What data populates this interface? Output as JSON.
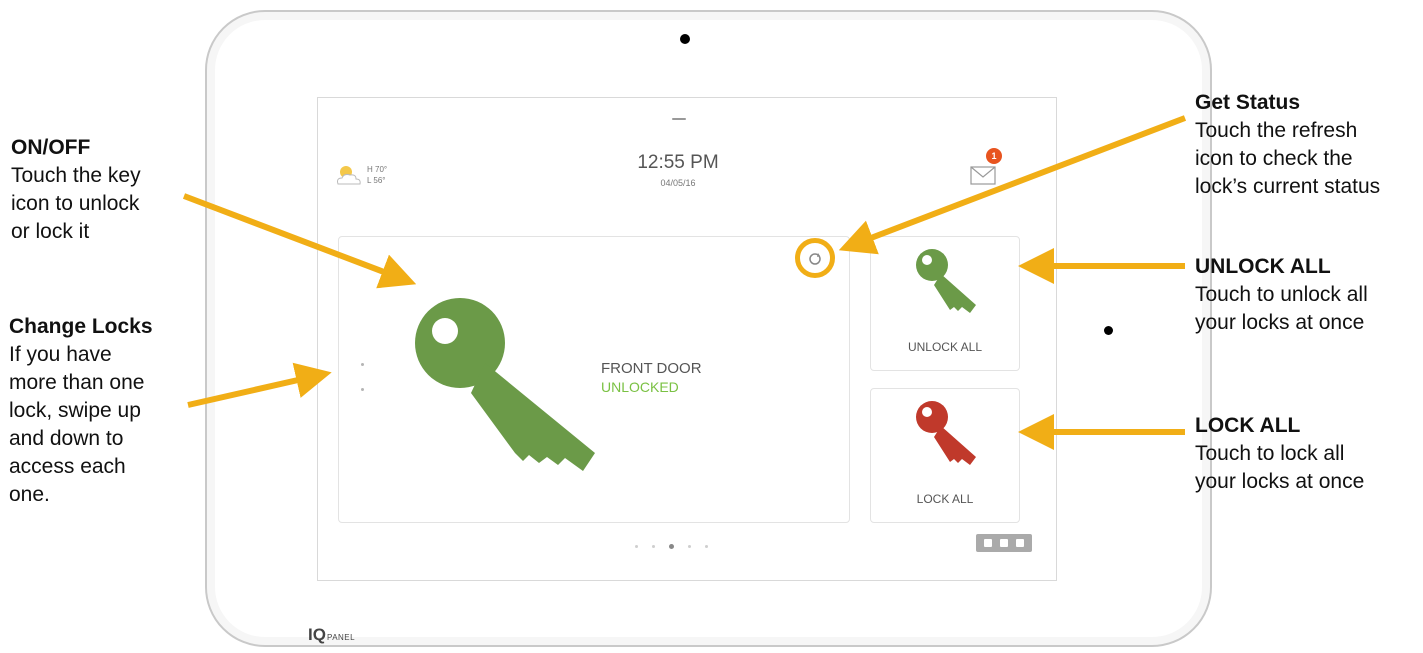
{
  "screen": {
    "weather": {
      "icon": "partly-cloudy-icon",
      "high": "H 70°",
      "low": "L 56°"
    },
    "time": "12:55 PM",
    "date": "04/05/16",
    "messages": {
      "icon": "envelope-icon",
      "badge": "1"
    },
    "lock": {
      "name": "FRONT DOOR",
      "status": "UNLOCKED",
      "status_color": "#7ac143",
      "key_color": "#6b9a48"
    },
    "buttons": {
      "unlock_all": {
        "label": "UNLOCK ALL",
        "key_color": "#6b9a48"
      },
      "lock_all": {
        "label": "LOCK ALL",
        "key_color": "#c0392b"
      }
    },
    "refresh_icon": "refresh-icon"
  },
  "device": {
    "brand": "IQ",
    "brand_sub": "PANEL"
  },
  "annotations": {
    "on_off": {
      "title": "ON/OFF",
      "body": [
        "Touch the key",
        "icon to unlock",
        "or lock it"
      ]
    },
    "change_locks": {
      "title": "Change Locks",
      "body": [
        "If you have",
        "more than one",
        "lock, swipe up",
        "and down to",
        "access each",
        "one."
      ]
    },
    "get_status": {
      "title": "Get Status",
      "body": [
        "Touch the refresh",
        "icon to check the",
        "lock’s current status"
      ]
    },
    "unlock_all": {
      "title": "UNLOCK ALL",
      "body": [
        "Touch to unlock all",
        "your locks at once"
      ]
    },
    "lock_all": {
      "title": "LOCK ALL",
      "body": [
        "Touch to lock all",
        "your locks at once"
      ]
    }
  },
  "colors": {
    "arrow": "#f1ae16"
  }
}
